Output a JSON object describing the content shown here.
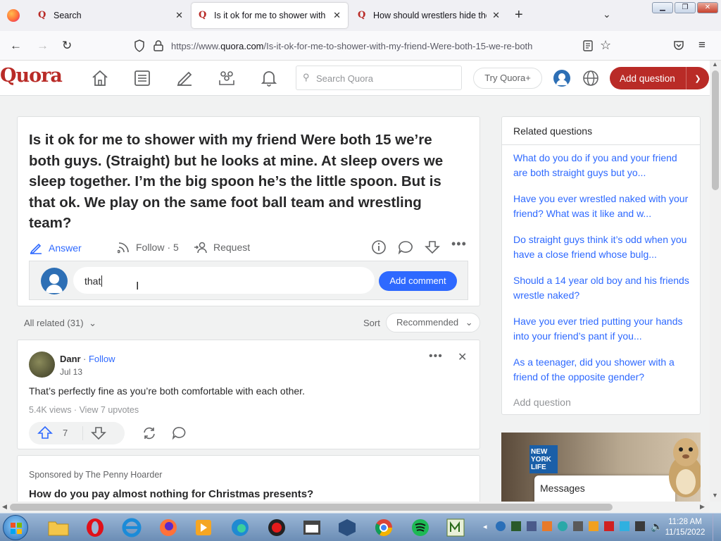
{
  "browser": {
    "tabs": [
      {
        "title": "Search",
        "active": false
      },
      {
        "title": "Is it ok for me to shower with m",
        "active": true
      },
      {
        "title": "How should wrestlers hide their",
        "active": false
      }
    ],
    "url_prefix": "https://www.",
    "url_host": "quora.com",
    "url_path": "/Is-it-ok-for-me-to-shower-with-my-friend-Were-both-15-we-re-both"
  },
  "quora_header": {
    "logo": "Quora",
    "search_placeholder": "Search Quora",
    "try_plus": "Try Quora+",
    "add_question": "Add question"
  },
  "question": {
    "title": "Is it ok for me to shower with my friend Were both 15 we’re both guys. (Straight) but he looks at mine. At sleep overs we sleep together. I’m the big spoon he’s the little spoon. But is that ok. We play on the same foot ball team and wrestling team?",
    "answer_label": "Answer",
    "follow_label": "Follow",
    "follow_count": "· 5",
    "request_label": "Request"
  },
  "comment": {
    "input_value": "that",
    "button": "Add comment"
  },
  "feed": {
    "all_related": "All related (31)",
    "sort_label": "Sort",
    "sort_value": "Recommended"
  },
  "answer": {
    "author": "Danr",
    "follow": "Follow",
    "date": "Jul 13",
    "text": "That’s perfectly fine as you’re both comfortable with each other.",
    "views": "5.4K views",
    "upvotes": "View 7 upvotes",
    "upvote_count": "7"
  },
  "sponsored": {
    "by": "Sponsored by The Penny Hoarder",
    "title": "How do you pay almost nothing for Christmas presents?"
  },
  "related": {
    "header": "Related questions",
    "items": [
      "What do you do if you and your friend are both straight guys but yo...",
      "Have you ever wrestled naked with your friend? What was it like and w...",
      "Do straight guys think it’s odd when you have a close friend whose bulg...",
      "Should a 14 year old boy and his friends wrestle naked?",
      "Have you ever tried putting your hands into your friend’s pant if you...",
      "As a teenager, did you shower with a friend of the opposite gender?"
    ],
    "add_question": "Add question"
  },
  "ad": {
    "brand": "NEW YORK LIFE",
    "messages": "Messages"
  },
  "taskbar": {
    "time": "11:28 AM",
    "date": "11/15/2022"
  },
  "colors": {
    "quora_red": "#b92b27",
    "link_blue": "#2e69ff",
    "page_bg": "#f1f2f2"
  }
}
